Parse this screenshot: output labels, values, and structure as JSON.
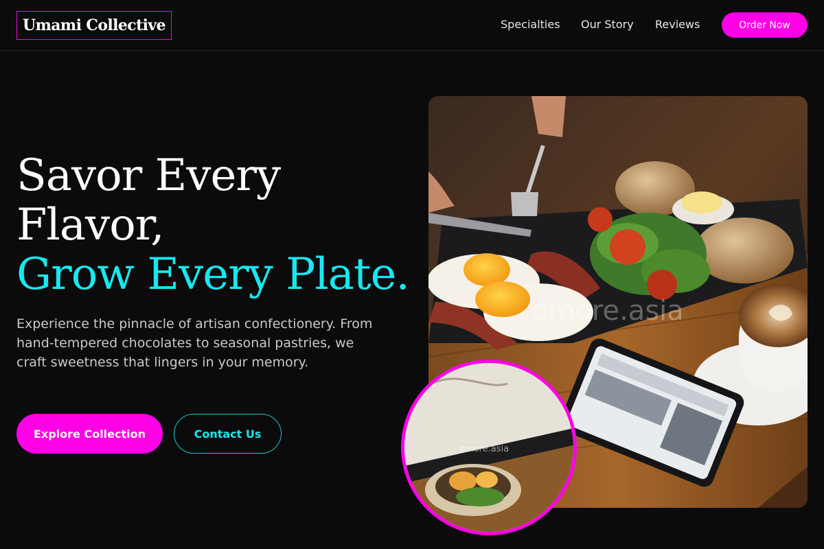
{
  "brand": {
    "name": "Umami Collective",
    "accent": "#ff00e6",
    "highlight": "#17e8f0"
  },
  "nav": {
    "items": [
      {
        "label": "Specialties"
      },
      {
        "label": "Our Story"
      },
      {
        "label": "Reviews"
      }
    ],
    "cta_label": "Order Now"
  },
  "hero": {
    "title_line1": "Savor Every",
    "title_line2": "Flavor,",
    "title_line3": "Grow Every Plate.",
    "description": "Experience the pinnacle of artisan confectionery. From hand-tempered chocolates to seasonal pastries, we craft sweetness that lingers in your memory.",
    "primary_button": "Explore Collection",
    "secondary_button": "Contact Us",
    "image_watermark": "omore.asia",
    "inset_watermark": "omore.asia"
  }
}
